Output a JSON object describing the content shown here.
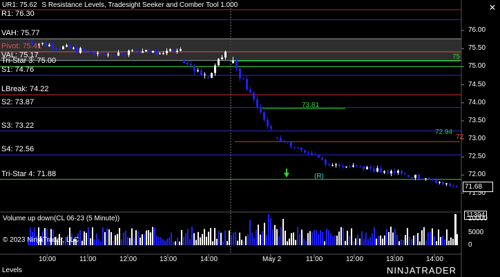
{
  "instrument_header": "UR1: 75.62",
  "indicator_title": "S Resistance Levels, Tradesight Seeker and Comber Tool 1.000",
  "close_glyph": "✕",
  "levels": [
    {
      "label": "R1: 76.30",
      "price": 76.3,
      "color": "#2b2bd6"
    },
    {
      "label": "VAH: 75.77",
      "price": 75.77,
      "color": "#9a9a9a"
    },
    {
      "label": "Pivot: 75.41",
      "price": 75.41,
      "color": "#e05050"
    },
    {
      "label": "VAL: 75.17",
      "price": 75.17,
      "color": "#9a9a9a"
    },
    {
      "label": "Tri-Star 3: 75.00",
      "price": 75.0,
      "color": "#2bd62b"
    },
    {
      "label": "S1: 74.76",
      "price": 74.76,
      "color": "#2b2bd6"
    },
    {
      "label": "LBreak: 74.22",
      "price": 74.22,
      "color": "#d62b2b"
    },
    {
      "label": "S2: 73.87",
      "price": 73.87,
      "color": "#2b2bd6"
    },
    {
      "label": "S3: 73.22",
      "price": 73.22,
      "color": "#2b2bd6"
    },
    {
      "label": "S4: 72.56",
      "price": 72.56,
      "color": "#2b2bd6"
    },
    {
      "label": "Tri-Star 4: 71.88",
      "price": 71.88,
      "color": "#2bd62b"
    }
  ],
  "price_axis": [
    "76.00",
    "75.50",
    "75.00",
    "74.50",
    "74.00",
    "73.50",
    "73.00",
    "72.50",
    "72.00",
    "71.50"
  ],
  "right_markers": [
    {
      "text": "75",
      "color": "#2bd62b"
    },
    {
      "text": "72.94",
      "color": "#2bd62b"
    },
    {
      "text": "72",
      "color": "#e05050"
    }
  ],
  "annotations": [
    "73.81",
    "(R)"
  ],
  "last_price": "71.68",
  "volume_title": "Volume up down(CL 06-23 (5 Minute))",
  "volume_axis": [
    "10000",
    "5000",
    "0"
  ],
  "volume_last": "11394",
  "copyright": "© 2023 NinjaTrader, LLC",
  "time_axis": [
    "10:00",
    "11:00",
    "12:00",
    "13:00",
    "14:00",
    "May 2",
    "11:00",
    "12:00",
    "13:00",
    "14:00"
  ],
  "footer_tab": "Levels",
  "logo_text": "NINJATRADER",
  "colors": {
    "up": "#ffffff",
    "down": "#2020ff",
    "bg": "#000000",
    "seq": "#2bd62b",
    "seq2": "#3bd6d6"
  }
}
